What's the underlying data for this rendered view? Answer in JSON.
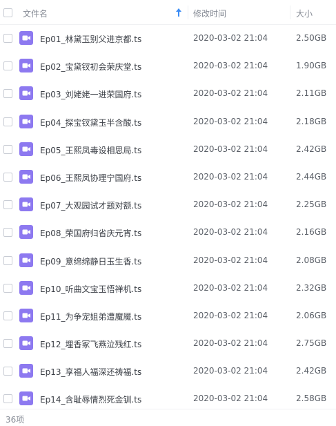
{
  "header": {
    "name_label": "文件名",
    "time_label": "修改时间",
    "size_label": "大小",
    "sort_icon": "arrow-up-icon"
  },
  "colors": {
    "video_icon": "#8d79f0",
    "sort_arrow": "#3b8cf5"
  },
  "files": [
    {
      "name": "Ep01_林黛玉别父进京都.ts",
      "time": "2020-03-02 21:04",
      "size": "2.50GB",
      "icon": "video-file-icon"
    },
    {
      "name": "Ep02_宝黛钗初会荣庆堂.ts",
      "time": "2020-03-02 21:04",
      "size": "1.90GB",
      "icon": "video-file-icon"
    },
    {
      "name": "Ep03_刘姥姥一进荣国府.ts",
      "time": "2020-03-02 21:04",
      "size": "2.11GB",
      "icon": "video-file-icon"
    },
    {
      "name": "Ep04_探宝钗黛玉半含酸.ts",
      "time": "2020-03-02 21:04",
      "size": "2.18GB",
      "icon": "video-file-icon"
    },
    {
      "name": "Ep05_王熙凤毒设相思局.ts",
      "time": "2020-03-02 21:04",
      "size": "2.42GB",
      "icon": "video-file-icon"
    },
    {
      "name": "Ep06_王熙凤协理宁国府.ts",
      "time": "2020-03-02 21:04",
      "size": "2.44GB",
      "icon": "video-file-icon"
    },
    {
      "name": "Ep07_大观园试才题对额.ts",
      "time": "2020-03-02 21:04",
      "size": "2.25GB",
      "icon": "video-file-icon"
    },
    {
      "name": "Ep08_荣国府归省庆元宵.ts",
      "time": "2020-03-02 21:04",
      "size": "2.16GB",
      "icon": "video-file-icon"
    },
    {
      "name": "Ep09_意绵绵静日玉生香.ts",
      "time": "2020-03-02 21:04",
      "size": "2.08GB",
      "icon": "video-file-icon"
    },
    {
      "name": "Ep10_听曲文宝玉悟禅机.ts",
      "time": "2020-03-02 21:04",
      "size": "2.32GB",
      "icon": "video-file-icon"
    },
    {
      "name": "Ep11_为争宠姐弟遭魔魇.ts",
      "time": "2020-03-02 21:04",
      "size": "2.06GB",
      "icon": "video-file-icon"
    },
    {
      "name": "Ep12_埋香冢飞燕泣残红.ts",
      "time": "2020-03-02 21:04",
      "size": "2.75GB",
      "icon": "video-file-icon"
    },
    {
      "name": "Ep13_享福人福深还祷福.ts",
      "time": "2020-03-02 21:04",
      "size": "2.42GB",
      "icon": "video-file-icon"
    },
    {
      "name": "Ep14_含耻辱情烈死金钏.ts",
      "time": "2020-03-02 21:04",
      "size": "2.58GB",
      "icon": "video-file-icon"
    }
  ],
  "footer": {
    "count": "36项"
  }
}
